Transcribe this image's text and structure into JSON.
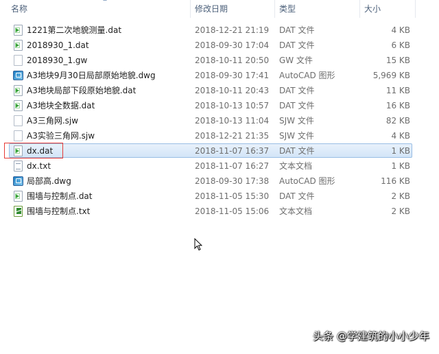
{
  "header": {
    "name": "名称",
    "date": "修改日期",
    "type": "类型",
    "size": "大小"
  },
  "files": [
    {
      "name": "1221第二次地貌测量.dat",
      "date": "2018-12-21 21:19",
      "type": "DAT 文件",
      "size": "4 KB",
      "icon": "dat-file-icon"
    },
    {
      "name": "2018930_1.dat",
      "date": "2018-09-30 17:04",
      "type": "DAT 文件",
      "size": "6 KB",
      "icon": "dat-file-icon"
    },
    {
      "name": "2018930_1.gw",
      "date": "2018-10-11 20:50",
      "type": "GW 文件",
      "size": "15 KB",
      "icon": "blank-file-icon"
    },
    {
      "name": "A3地块9月30日局部原始地貌.dwg",
      "date": "2018-09-30 17:41",
      "type": "AutoCAD 图形",
      "size": "5,969 KB",
      "icon": "autocad-file-icon"
    },
    {
      "name": "A3地块局部下段原始地貌.dat",
      "date": "2018-10-11 20:43",
      "type": "DAT 文件",
      "size": "11 KB",
      "icon": "dat-file-icon"
    },
    {
      "name": "A3地块全数据.dat",
      "date": "2018-10-13 10:57",
      "type": "DAT 文件",
      "size": "16 KB",
      "icon": "dat-file-icon"
    },
    {
      "name": "A3三角网.sjw",
      "date": "2018-10-13 11:04",
      "type": "SJW 文件",
      "size": "82 KB",
      "icon": "blank-file-icon"
    },
    {
      "name": "A3实验三角网.sjw",
      "date": "2018-12-21 21:35",
      "type": "SJW 文件",
      "size": "4 KB",
      "icon": "blank-file-icon"
    },
    {
      "name": "dx.dat",
      "date": "2018-11-07 16:37",
      "type": "DAT 文件",
      "size": "1 KB",
      "icon": "dat-file-icon",
      "selected": true
    },
    {
      "name": "dx.txt",
      "date": "2018-11-07 16:27",
      "type": "文本文档",
      "size": "1 KB",
      "icon": "text-file-icon"
    },
    {
      "name": "局部高.dwg",
      "date": "2018-09-30 17:38",
      "type": "AutoCAD 图形",
      "size": "116 KB",
      "icon": "autocad-file-icon"
    },
    {
      "name": "围墙与控制点.dat",
      "date": "2018-11-05 15:30",
      "type": "DAT 文件",
      "size": "2 KB",
      "icon": "dat-file-icon"
    },
    {
      "name": "围墙与控制点.txt",
      "date": "2018-11-05 15:06",
      "type": "文本文档",
      "size": "2 KB",
      "icon": "text-file-green-icon"
    }
  ],
  "watermark": "头条 @学建筑的小小少年"
}
